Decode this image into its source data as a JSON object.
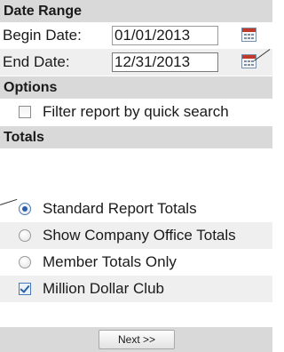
{
  "date_range": {
    "header": "Date Range",
    "begin_label": "Begin Date:",
    "begin_value": "01/01/2013",
    "end_label": "End Date:",
    "end_value": "12/31/2013"
  },
  "options": {
    "header": "Options",
    "filter_label": "Filter report by quick search",
    "filter_checked": false
  },
  "totals": {
    "header": "Totals",
    "items": [
      {
        "label": "Standard Report Totals",
        "selected": true
      },
      {
        "label": "Show Company Office Totals",
        "selected": false
      },
      {
        "label": "Member Totals Only",
        "selected": false
      }
    ],
    "million_label": "Million Dollar Club",
    "million_checked": true
  },
  "actions": {
    "next_label": "Next >>"
  },
  "colors": {
    "header_bg": "#d9d9d9",
    "row_alt_bg": "#efefef",
    "accent": "#2a5fa8"
  }
}
